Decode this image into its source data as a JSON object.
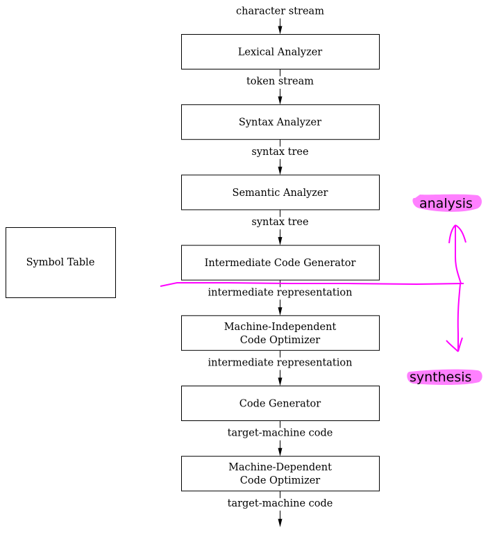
{
  "phases": [
    {
      "lines": [
        "Lexical Analyzer"
      ]
    },
    {
      "lines": [
        "Syntax Analyzer"
      ]
    },
    {
      "lines": [
        "Semantic Analyzer"
      ]
    },
    {
      "lines": [
        "Intermediate Code Generator"
      ]
    },
    {
      "lines": [
        "Machine-Independent",
        "Code Optimizer"
      ]
    },
    {
      "lines": [
        "Code Generator"
      ]
    },
    {
      "lines": [
        "Machine-Dependent",
        "Code Optimizer"
      ]
    }
  ],
  "streams": [
    "character stream",
    "token stream",
    "syntax tree",
    "syntax tree",
    "intermediate representation",
    "intermediate representation",
    "target-machine code",
    "target-machine code"
  ],
  "symbol_table": "Symbol Table",
  "annotations": {
    "analysis": "analysis",
    "synthesis": "synthesis",
    "highlight_color": "#ff80ff",
    "pen_color": "#ff00ff"
  }
}
